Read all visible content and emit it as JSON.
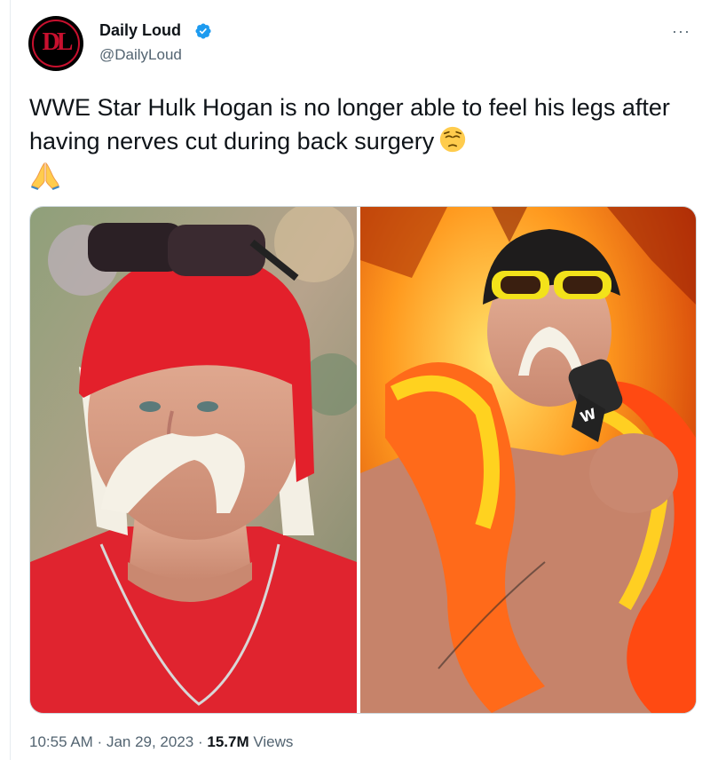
{
  "author": {
    "display_name": "Daily Loud",
    "handle": "@DailyLoud",
    "verified": true,
    "avatar_monogram": "DL",
    "verified_color": "#1d9bf0"
  },
  "menu": {
    "more_label": "···"
  },
  "tweet": {
    "text": "WWE Star Hulk Hogan is no longer able to feel his legs after having nerves cut during back surgery",
    "emojis": [
      "pensive-face",
      "folded-hands"
    ]
  },
  "media": {
    "images": [
      {
        "subject": "portrait-red-bandana"
      },
      {
        "subject": "wrestler-with-microphone"
      }
    ]
  },
  "footer": {
    "time": "10:55 AM",
    "separator": " · ",
    "date": "Jan 29, 2023",
    "views_count": "15.7M",
    "views_label": "Views"
  }
}
